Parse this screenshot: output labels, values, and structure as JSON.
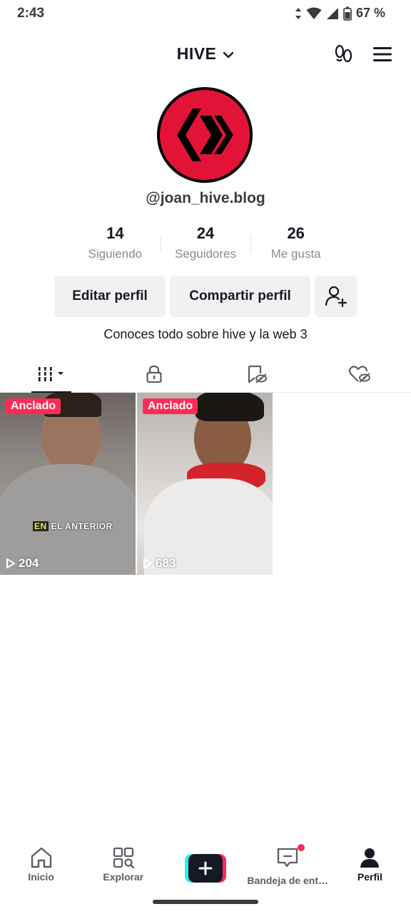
{
  "status_bar": {
    "time": "2:43",
    "battery": "67 %"
  },
  "header": {
    "account_name": "HIVE"
  },
  "profile": {
    "username": "@joan_hive.blog",
    "bio": "Conoces todo sobre hive y la web 3",
    "avatar_colors": {
      "ring": "#000000",
      "logo": "#e31337"
    }
  },
  "stats": [
    {
      "value": "14",
      "label": "Siguiendo"
    },
    {
      "value": "24",
      "label": "Seguidores"
    },
    {
      "value": "26",
      "label": "Me gusta"
    }
  ],
  "actions": {
    "edit": "Editar perfil",
    "share": "Compartir perfil"
  },
  "tabs": [
    {
      "name": "videos",
      "icon": "grid-icon",
      "active": true
    },
    {
      "name": "private",
      "icon": "lock-icon",
      "active": false
    },
    {
      "name": "reposts",
      "icon": "hidden-bookmark-icon",
      "active": false
    },
    {
      "name": "liked",
      "icon": "hidden-heart-icon",
      "active": false
    }
  ],
  "videos": [
    {
      "pinned_label": "Anclado",
      "views": "204",
      "caption_highlight": "EN",
      "caption_rest": "EL ANTERIOR"
    },
    {
      "pinned_label": "Anclado",
      "views": "683"
    }
  ],
  "bottom_nav": [
    {
      "label": "Inicio",
      "icon": "home-icon"
    },
    {
      "label": "Explorar",
      "icon": "explore-icon"
    },
    {
      "label": "",
      "icon": "create-plus-icon"
    },
    {
      "label": "Bandeja de ent…",
      "icon": "inbox-icon",
      "badge": true
    },
    {
      "label": "Perfil",
      "icon": "profile-icon",
      "active": true
    }
  ],
  "colors": {
    "accent": "#fe2c55",
    "cyan": "#25f4ee",
    "text": "#161823",
    "muted": "#8a8b91"
  }
}
